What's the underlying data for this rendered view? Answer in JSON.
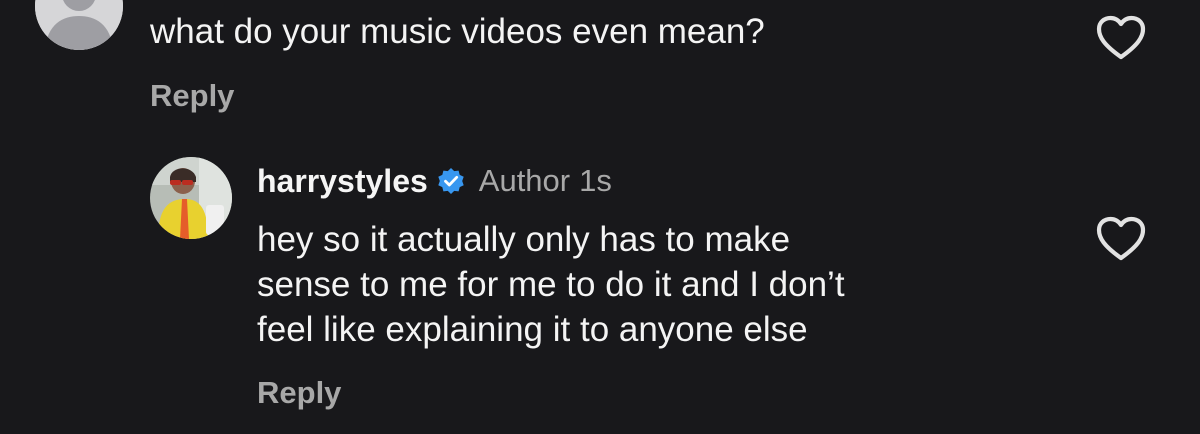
{
  "top_comment": {
    "text": "what do your music videos even mean?",
    "reply_label": "Reply",
    "avatar_icon": "default-avatar-icon",
    "like_icon": "heart-outline-icon"
  },
  "reply_comment": {
    "username": "harrystyles",
    "verified_icon": "verified-badge-icon",
    "author_tag": "Author",
    "timestamp": "1s",
    "text_lines": [
      "hey so it actually only has to make",
      "sense to me for me to do it and I don’t",
      "feel like explaining it to anyone else"
    ],
    "reply_label": "Reply",
    "like_icon": "heart-outline-icon"
  },
  "colors": {
    "background": "#18181b",
    "primary_text": "#f4f4f4",
    "secondary_text": "#a8a8a8",
    "verified": "#3897f0"
  }
}
